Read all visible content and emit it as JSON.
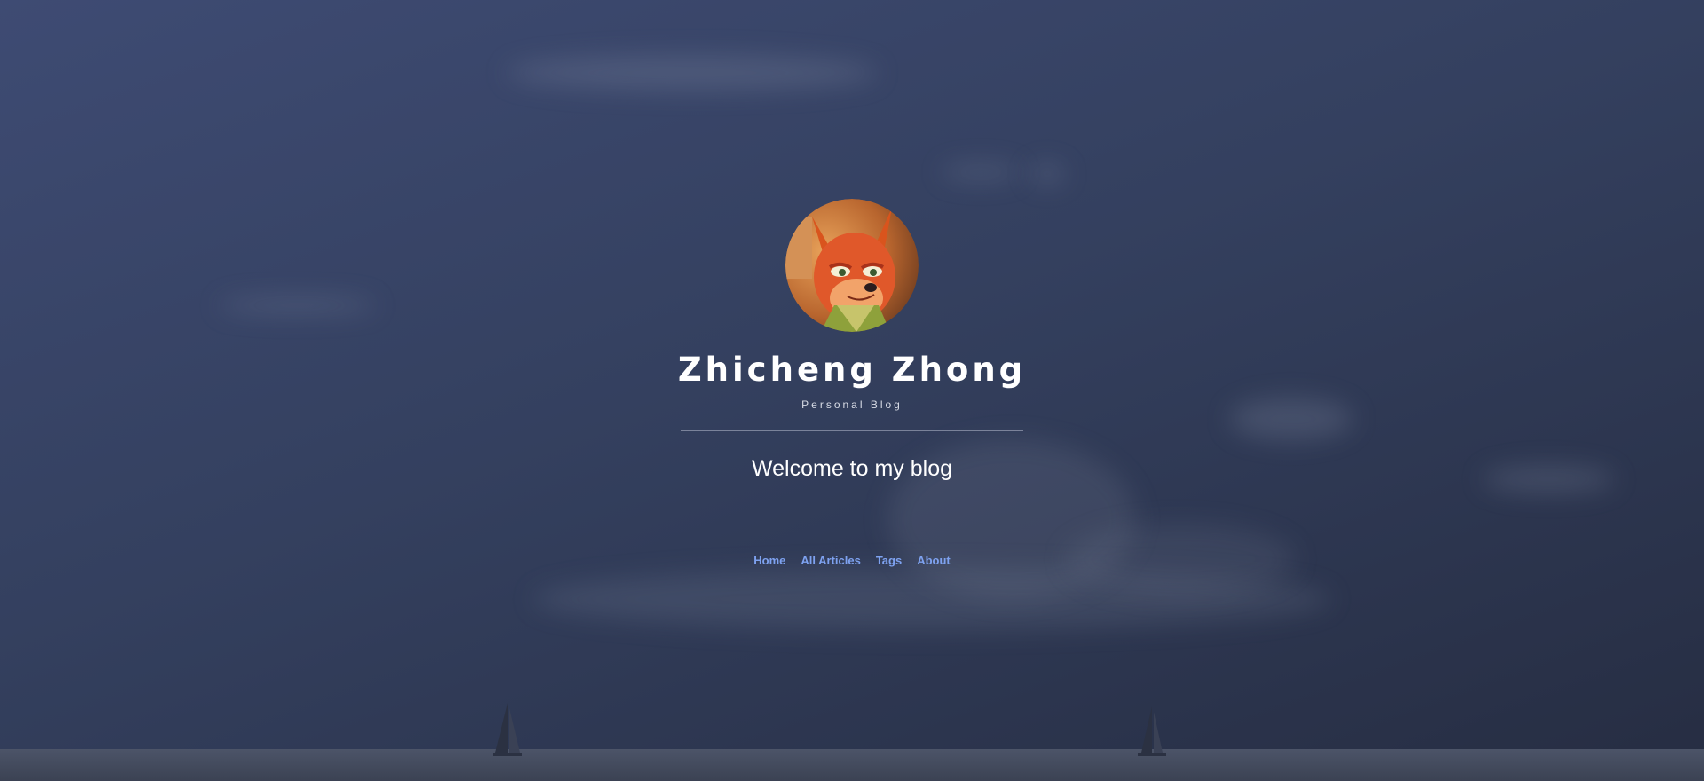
{
  "header": {
    "title": "Zhicheng Zhong",
    "subtitle": "Personal Blog",
    "welcome": "Welcome to my blog"
  },
  "avatar": {
    "icon": "fox-avatar-icon"
  },
  "nav": {
    "items": [
      {
        "label": "Home"
      },
      {
        "label": "All Articles"
      },
      {
        "label": "Tags"
      },
      {
        "label": "About"
      }
    ]
  },
  "colors": {
    "background_top": "#3e4b73",
    "background_bottom": "#262d42",
    "link": "#7ea2f0",
    "text": "#ffffff"
  }
}
